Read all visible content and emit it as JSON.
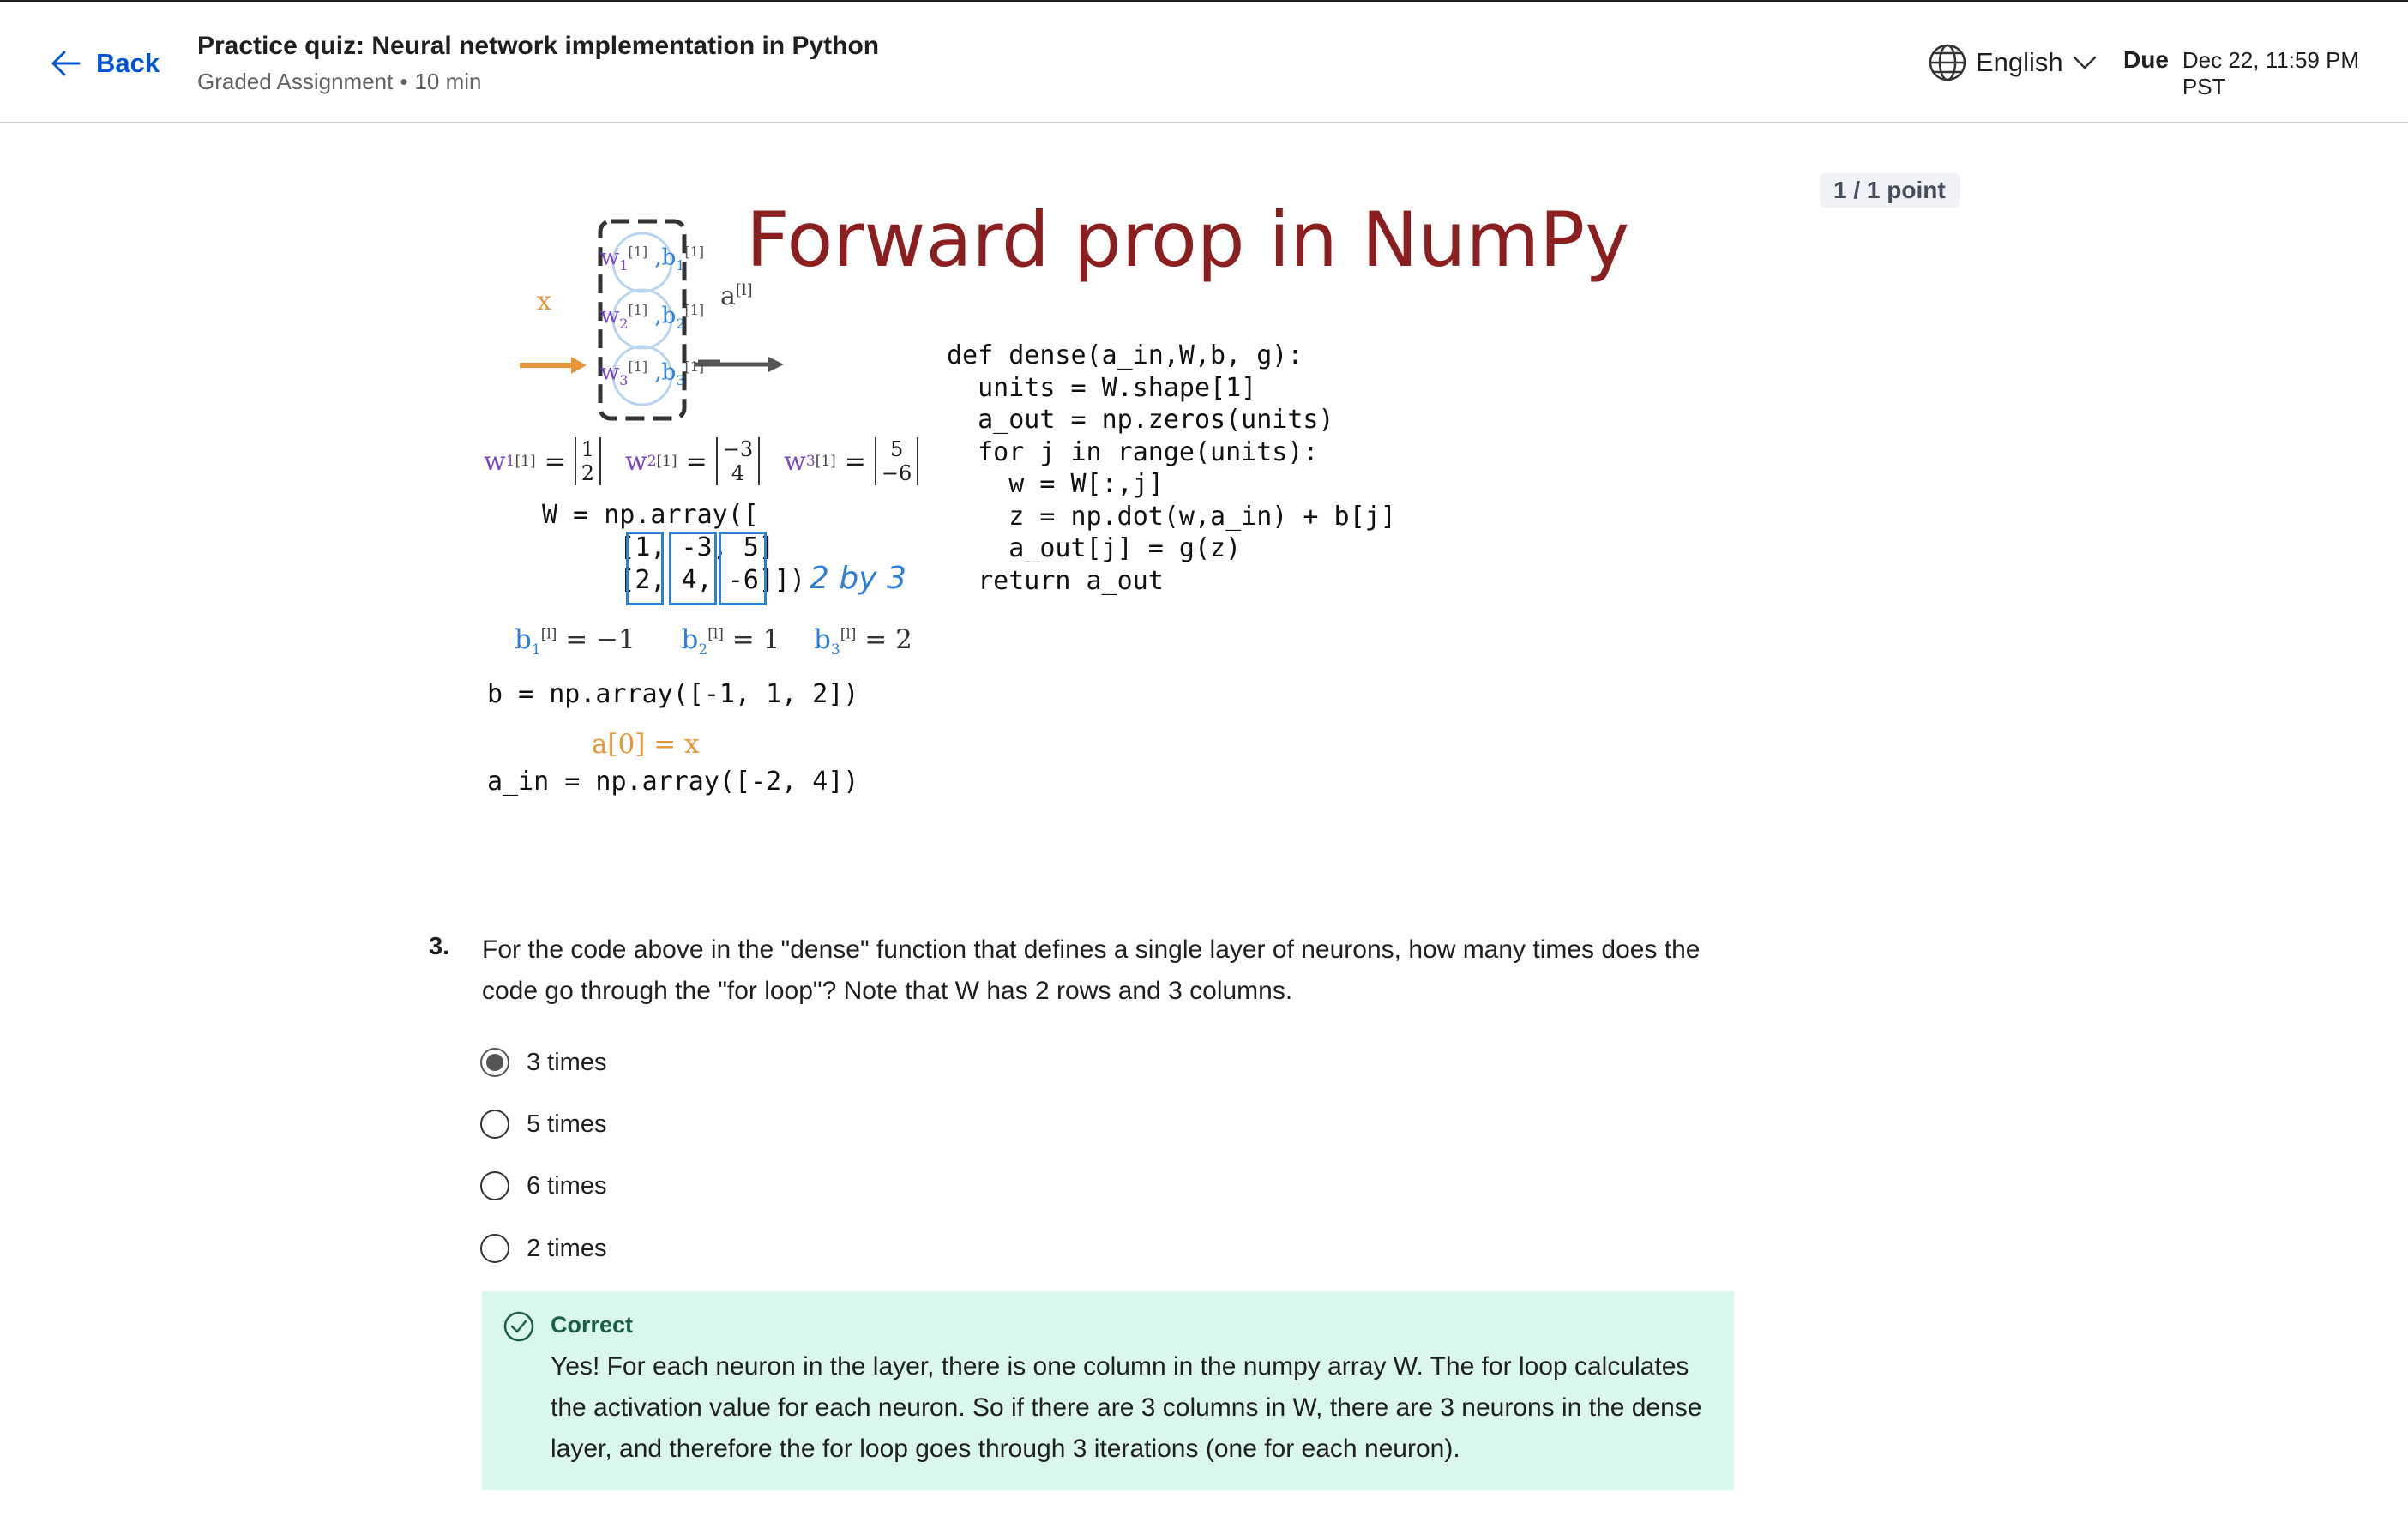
{
  "header": {
    "back_label": "Back",
    "title": "Practice quiz: Neural network implementation in Python",
    "assignment_type": "Graded Assignment",
    "separator": "•",
    "duration": "10 min",
    "language": "English",
    "due_label": "Due",
    "due_value": "Dec 22, 11:59 PM PST"
  },
  "score": "1 / 1 point",
  "slide": {
    "title": "Forward prop in NumPy",
    "code_dense": "def dense(a_in,W,b, g):\n  units = W.shape[1]\n  a_out = np.zeros(units)\n  for j in range(units):\n    w = W[:,j]\n    z = np.dot(w,a_in) + b[j]\n    a_out[j] = g(z)\n  return a_out",
    "code_W": "W = np.array([\n     [1, -3, 5]\n     [2, 4, -6]])",
    "code_b": "b = np.array([-1, 1, 2])",
    "code_ain": "a_in = np.array([-2, 4])",
    "note_2by3": "2 by 3",
    "b_values": [
      "= −1",
      "= 1",
      "= 2"
    ],
    "w1": [
      "1",
      "2"
    ],
    "w2": [
      "−3",
      "4"
    ],
    "w3": [
      "5",
      "−6"
    ],
    "input_label": "x",
    "output_label": "a",
    "a0_label": "a[0] = x"
  },
  "question": {
    "number": "3.",
    "text": "For the code above in the \"dense\" function that defines a single layer of neurons, how many times does the code go through the \"for loop\"? Note that W has 2 rows and 3 columns.",
    "options": [
      "3 times",
      "5 times",
      "6 times",
      "2 times"
    ],
    "selected_index": 0
  },
  "feedback": {
    "status": "Correct",
    "text": "Yes! For each neuron in the layer, there is one column in the numpy array W. The for loop calculates the activation value for each neuron. So if there are 3 columns in W, there are 3 neurons in the dense layer, and therefore the for loop goes through 3 iterations (one for each neuron).",
    "color": "#d9f7ec"
  }
}
